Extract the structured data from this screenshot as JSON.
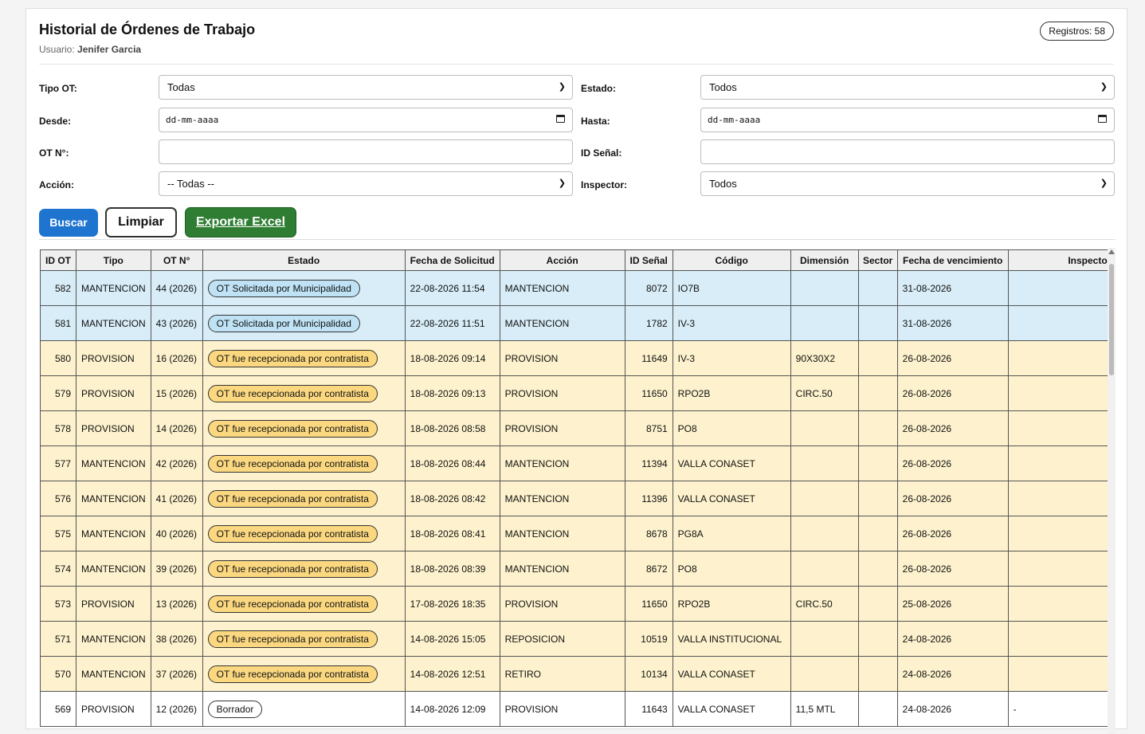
{
  "header": {
    "title": "Historial de Órdenes de Trabajo",
    "user_label": "Usuario:",
    "user_name": "Jenifer Garcia",
    "records": "Registros: 58"
  },
  "filters": {
    "tipo_ot": {
      "label": "Tipo OT:",
      "value": "Todas"
    },
    "estado": {
      "label": "Estado:",
      "value": "Todos"
    },
    "desde": {
      "label": "Desde:",
      "placeholder": "dd-mm-aaaa"
    },
    "hasta": {
      "label": "Hasta:",
      "placeholder": "dd-mm-aaaa"
    },
    "ot_no": {
      "label": "OT N°:",
      "value": ""
    },
    "id_senal": {
      "label": "ID Señal:",
      "value": ""
    },
    "accion": {
      "label": "Acción:",
      "value": "-- Todas --"
    },
    "inspector": {
      "label": "Inspector:",
      "value": "Todos"
    }
  },
  "buttons": {
    "buscar": "Buscar",
    "limpiar": "Limpiar",
    "exportar": "Exportar Excel"
  },
  "table": {
    "headers": [
      "ID OT",
      "Tipo",
      "OT N°",
      "Estado",
      "Fecha de Solicitud",
      "Acción",
      "ID Señal",
      "Código",
      "Dimensión",
      "Sector",
      "Fecha de vencimiento",
      "Inspecto"
    ],
    "rows": [
      {
        "id": "582",
        "tipo": "MANTENCION",
        "ot": "44 (2026)",
        "estado": "OT Solicitada por Municipalidad",
        "fecha": "22-08-2026 11:54",
        "accion": "MANTENCION",
        "senal": "8072",
        "codigo": "IO7B",
        "dim": "",
        "sector": "",
        "venc": "31-08-2026",
        "inspector": "",
        "tone": "blue"
      },
      {
        "id": "581",
        "tipo": "MANTENCION",
        "ot": "43 (2026)",
        "estado": "OT Solicitada por Municipalidad",
        "fecha": "22-08-2026 11:51",
        "accion": "MANTENCION",
        "senal": "1782",
        "codigo": "IV-3",
        "dim": "",
        "sector": "",
        "venc": "31-08-2026",
        "inspector": "",
        "tone": "blue"
      },
      {
        "id": "580",
        "tipo": "PROVISION",
        "ot": "16 (2026)",
        "estado": "OT fue recepcionada por contratista",
        "fecha": "18-08-2026 09:14",
        "accion": "PROVISION",
        "senal": "11649",
        "codigo": "IV-3",
        "dim": "90X30X2",
        "sector": "",
        "venc": "26-08-2026",
        "inspector": "",
        "tone": "yellow"
      },
      {
        "id": "579",
        "tipo": "PROVISION",
        "ot": "15 (2026)",
        "estado": "OT fue recepcionada por contratista",
        "fecha": "18-08-2026 09:13",
        "accion": "PROVISION",
        "senal": "11650",
        "codigo": "RPO2B",
        "dim": "CIRC.50",
        "sector": "",
        "venc": "26-08-2026",
        "inspector": "",
        "tone": "yellow"
      },
      {
        "id": "578",
        "tipo": "PROVISION",
        "ot": "14 (2026)",
        "estado": "OT fue recepcionada por contratista",
        "fecha": "18-08-2026 08:58",
        "accion": "PROVISION",
        "senal": "8751",
        "codigo": "PO8",
        "dim": "",
        "sector": "",
        "venc": "26-08-2026",
        "inspector": "",
        "tone": "yellow"
      },
      {
        "id": "577",
        "tipo": "MANTENCION",
        "ot": "42 (2026)",
        "estado": "OT fue recepcionada por contratista",
        "fecha": "18-08-2026 08:44",
        "accion": "MANTENCION",
        "senal": "11394",
        "codigo": "VALLA CONASET",
        "dim": "",
        "sector": "",
        "venc": "26-08-2026",
        "inspector": "",
        "tone": "yellow"
      },
      {
        "id": "576",
        "tipo": "MANTENCION",
        "ot": "41 (2026)",
        "estado": "OT fue recepcionada por contratista",
        "fecha": "18-08-2026 08:42",
        "accion": "MANTENCION",
        "senal": "11396",
        "codigo": "VALLA CONASET",
        "dim": "",
        "sector": "",
        "venc": "26-08-2026",
        "inspector": "",
        "tone": "yellow"
      },
      {
        "id": "575",
        "tipo": "MANTENCION",
        "ot": "40 (2026)",
        "estado": "OT fue recepcionada por contratista",
        "fecha": "18-08-2026 08:41",
        "accion": "MANTENCION",
        "senal": "8678",
        "codigo": "PG8A",
        "dim": "",
        "sector": "",
        "venc": "26-08-2026",
        "inspector": "",
        "tone": "yellow"
      },
      {
        "id": "574",
        "tipo": "MANTENCION",
        "ot": "39 (2026)",
        "estado": "OT fue recepcionada por contratista",
        "fecha": "18-08-2026 08:39",
        "accion": "MANTENCION",
        "senal": "8672",
        "codigo": "PO8",
        "dim": "",
        "sector": "",
        "venc": "26-08-2026",
        "inspector": "",
        "tone": "yellow"
      },
      {
        "id": "573",
        "tipo": "PROVISION",
        "ot": "13 (2026)",
        "estado": "OT fue recepcionada por contratista",
        "fecha": "17-08-2026 18:35",
        "accion": "PROVISION",
        "senal": "11650",
        "codigo": "RPO2B",
        "dim": "CIRC.50",
        "sector": "",
        "venc": "25-08-2026",
        "inspector": "",
        "tone": "yellow"
      },
      {
        "id": "571",
        "tipo": "MANTENCION",
        "ot": "38 (2026)",
        "estado": "OT fue recepcionada por contratista",
        "fecha": "14-08-2026 15:05",
        "accion": "REPOSICION",
        "senal": "10519",
        "codigo": "VALLA INSTITUCIONAL",
        "dim": "",
        "sector": "",
        "venc": "24-08-2026",
        "inspector": "",
        "tone": "yellow"
      },
      {
        "id": "570",
        "tipo": "MANTENCION",
        "ot": "37 (2026)",
        "estado": "OT fue recepcionada por contratista",
        "fecha": "14-08-2026 12:51",
        "accion": "RETIRO",
        "senal": "10134",
        "codigo": "VALLA CONASET",
        "dim": "",
        "sector": "",
        "venc": "24-08-2026",
        "inspector": "",
        "tone": "yellow"
      },
      {
        "id": "569",
        "tipo": "PROVISION",
        "ot": "12 (2026)",
        "estado": "Borrador",
        "fecha": "14-08-2026 12:09",
        "accion": "PROVISION",
        "senal": "11643",
        "codigo": "VALLA CONASET",
        "dim": "11,5 MTL",
        "sector": "",
        "venc": "24-08-2026",
        "inspector": "-",
        "tone": "white"
      }
    ]
  }
}
